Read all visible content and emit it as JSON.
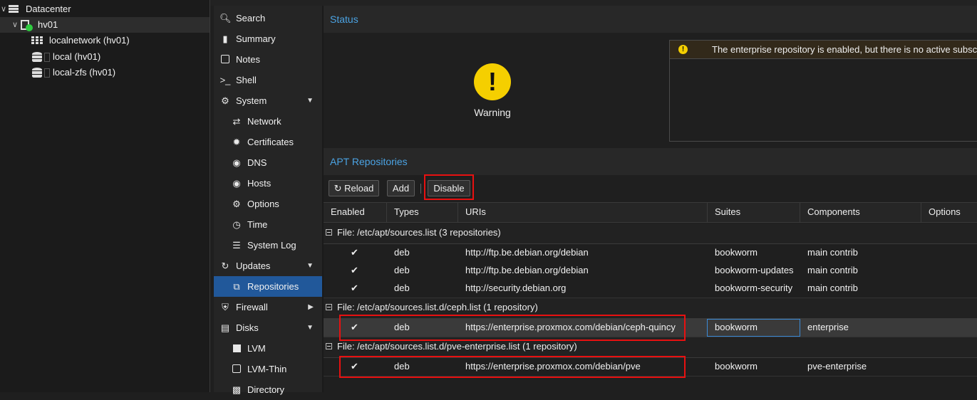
{
  "tree": {
    "datacenter": "Datacenter",
    "node": "hv01",
    "children": [
      "localnetwork (hv01)",
      "local (hv01)",
      "local-zfs (hv01)"
    ]
  },
  "nav": {
    "items": [
      {
        "label": "Search",
        "icon": "search-icon"
      },
      {
        "label": "Summary",
        "icon": "book-icon"
      },
      {
        "label": "Notes",
        "icon": "note-icon"
      },
      {
        "label": "Shell",
        "icon": "terminal-icon"
      },
      {
        "label": "System",
        "icon": "gears-icon"
      },
      {
        "label": "Network",
        "icon": "exchange-icon"
      },
      {
        "label": "Certificates",
        "icon": "certificate-icon"
      },
      {
        "label": "DNS",
        "icon": "globe-icon"
      },
      {
        "label": "Hosts",
        "icon": "globe-icon"
      },
      {
        "label": "Options",
        "icon": "gear-icon"
      },
      {
        "label": "Time",
        "icon": "clock-icon"
      },
      {
        "label": "System Log",
        "icon": "list-icon"
      },
      {
        "label": "Updates",
        "icon": "refresh-icon"
      },
      {
        "label": "Repositories",
        "icon": "copy-icon"
      },
      {
        "label": "Firewall",
        "icon": "shield-icon"
      },
      {
        "label": "Disks",
        "icon": "hdd-icon"
      },
      {
        "label": "LVM",
        "icon": "square-icon"
      },
      {
        "label": "LVM-Thin",
        "icon": "square-outline-icon"
      },
      {
        "label": "Directory",
        "icon": "folder-icon"
      }
    ]
  },
  "status": {
    "title": "Status",
    "warning_label": "Warning",
    "message": "The enterprise repository is enabled, but there is no active subscription!"
  },
  "repos": {
    "title": "APT Repositories",
    "toolbar": {
      "reload": "Reload",
      "add": "Add",
      "disable": "Disable"
    },
    "columns": [
      "Enabled",
      "Types",
      "URIs",
      "Suites",
      "Components",
      "Options"
    ],
    "groups": [
      {
        "title": "File: /etc/apt/sources.list (3 repositories)",
        "rows": [
          {
            "types": "deb",
            "uri": "http://ftp.be.debian.org/debian",
            "suites": "bookworm",
            "components": "main contrib"
          },
          {
            "types": "deb",
            "uri": "http://ftp.be.debian.org/debian",
            "suites": "bookworm-updates",
            "components": "main contrib"
          },
          {
            "types": "deb",
            "uri": "http://security.debian.org",
            "suites": "bookworm-security",
            "components": "main contrib"
          }
        ]
      },
      {
        "title": "File: /etc/apt/sources.list.d/ceph.list (1 repository)",
        "rows": [
          {
            "types": "deb",
            "uri": "https://enterprise.proxmox.com/debian/ceph-quincy",
            "suites": "bookworm",
            "components": "enterprise"
          }
        ]
      },
      {
        "title": "File: /etc/apt/sources.list.d/pve-enterprise.list (1 repository)",
        "rows": [
          {
            "types": "deb",
            "uri": "https://enterprise.proxmox.com/debian/pve",
            "suites": "bookworm",
            "components": "pve-enterprise"
          }
        ]
      }
    ]
  },
  "colors": {
    "accent_blue": "#4ba3e3",
    "selected_nav": "#21589a",
    "warning_yellow": "#f5cf00",
    "highlight_red": "#e81010"
  }
}
